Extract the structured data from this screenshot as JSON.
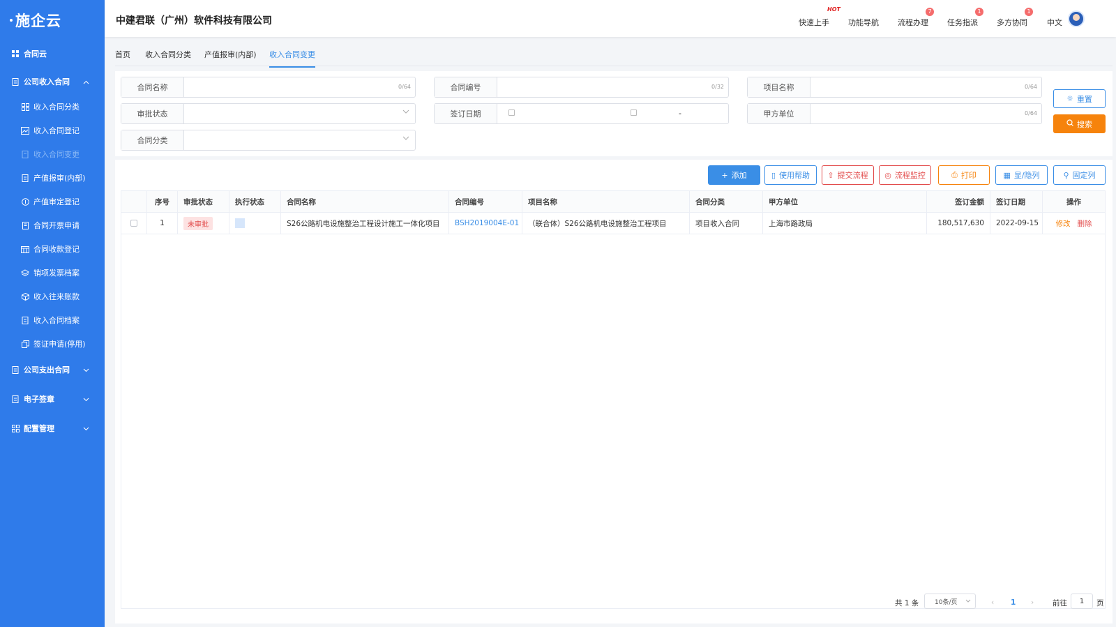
{
  "sidebar": {
    "logo": "施企云",
    "items": [
      {
        "label": "合同云"
      },
      {
        "label": "公司收入合同"
      },
      {
        "label": "收入合同分类"
      },
      {
        "label": "收入合同登记"
      },
      {
        "label": "收入合同变更"
      },
      {
        "label": "产值报审(内部)"
      },
      {
        "label": "产值审定登记"
      },
      {
        "label": "合同开票申请"
      },
      {
        "label": "合同收款登记"
      },
      {
        "label": "销项发票档案"
      },
      {
        "label": "收入往来账款"
      },
      {
        "label": "收入合同档案"
      },
      {
        "label": "签证申请(停用)"
      },
      {
        "label": "公司支出合同"
      },
      {
        "label": "电子签章"
      },
      {
        "label": "配置管理"
      }
    ]
  },
  "header": {
    "company": "中建君联（广州）软件科技有限公司",
    "links": [
      {
        "label": "快速上手",
        "badge": "HOT"
      },
      {
        "label": "功能导航",
        "badge": ""
      },
      {
        "label": "流程办理",
        "badge": "7"
      },
      {
        "label": "任务指派",
        "badge": "1"
      },
      {
        "label": "多方协同",
        "badge": "1"
      }
    ],
    "language": "中文"
  },
  "tabs": [
    {
      "label": "首页"
    },
    {
      "label": "收入合同分类"
    },
    {
      "label": "产值报审(内部)"
    },
    {
      "label": "收入合同变更"
    }
  ],
  "search": {
    "contract_name": {
      "label": "合同名称",
      "count": "0/64"
    },
    "contract_no": {
      "label": "合同编号",
      "count": "0/32"
    },
    "project_name": {
      "label": "项目名称",
      "count": "0/64"
    },
    "approval_status": {
      "label": "审批状态"
    },
    "sign_date": {
      "label": "签订日期",
      "separator": "-"
    },
    "party_a": {
      "label": "甲方单位",
      "count": "0/64"
    },
    "contract_type": {
      "label": "合同分类"
    },
    "reset_label": "重置",
    "search_label": "搜索"
  },
  "toolbar": {
    "add": "添加",
    "help": "使用帮助",
    "submit": "提交流程",
    "monitor": "流程监控",
    "print": "打印",
    "toggle_cols": "显/隐列",
    "fix_cols": "固定列"
  },
  "table": {
    "headers": [
      "序号",
      "审批状态",
      "执行状态",
      "合同名称",
      "合同编号",
      "项目名称",
      "合同分类",
      "甲方单位",
      "签订金额",
      "签订日期",
      "操作"
    ],
    "rows": [
      {
        "index": "1",
        "approval": "未审批",
        "name": "S26公路机电设施整治工程设计施工一体化项目",
        "no": "BSH2019004E-01",
        "project": "（联合体）S26公路机电设施整治工程项目",
        "type": "项目收入合同",
        "party_a": "上海市路政局",
        "amount": "180,517,630",
        "date": "2022-09-15",
        "edit": "修改",
        "delete": "删除"
      }
    ]
  },
  "pagination": {
    "total": "共 1 条",
    "page_size": "10条/页",
    "current": "1",
    "goto_prefix": "前往",
    "goto_value": "1",
    "goto_suffix": "页"
  },
  "colors": {
    "sidebar": "#2f7bea",
    "primary": "#3a8ee6",
    "orange": "#f6830c",
    "red": "#e24b4b"
  }
}
